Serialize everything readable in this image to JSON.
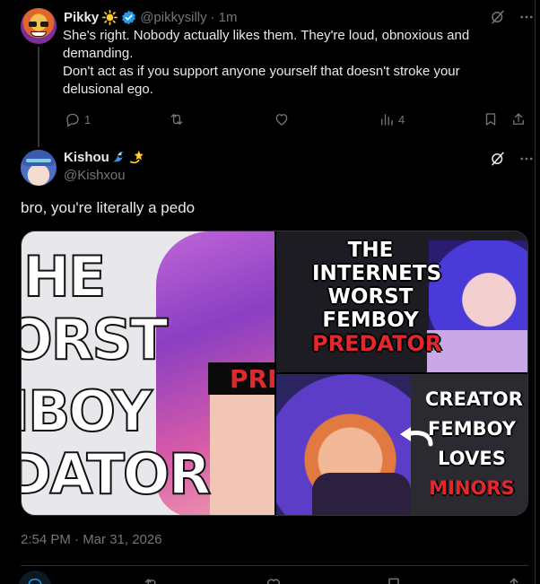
{
  "reply": {
    "author_name": "Pikky",
    "author_handle": "@pikkysilly",
    "separator": "·",
    "time": "1m",
    "text_lines": [
      "She's right. Nobody actually likes them. They're loud, obnoxious and demanding.",
      "Don't act as if you support anyone yourself that doesn't stroke your delusional ego."
    ],
    "stats": {
      "replies": "1",
      "retweets": "",
      "likes": "",
      "views": "4"
    }
  },
  "tweet": {
    "author_name": "Kishou",
    "author_handle": "@Kishxou",
    "text": "bro, you're literally a pedo",
    "timestamp": "2:54 PM · Mar 31, 2026",
    "media": {
      "image1_lines": [
        "HE",
        "ORST",
        "IBOY",
        "DATOR"
      ],
      "image1_overlay": "PRE",
      "image2_lines": [
        "THE",
        "INTERNETS",
        "WORST",
        "FEMBOY"
      ],
      "image2_highlight": "PREDATOR",
      "image3_lines": [
        "CREATOR",
        "FEMBOY",
        "LOVES"
      ],
      "image3_highlight": "MINORS"
    }
  },
  "colors": {
    "background": "#000000",
    "text_primary": "#e7e9ea",
    "text_secondary": "#71767b",
    "accent": "#1d9bf0",
    "divider": "#2f3336",
    "red_label": "#e0282e"
  },
  "icons": [
    "verified-badge-icon",
    "sun-emoji-icon",
    "wave-emoji-icon",
    "dizzy-emoji-icon",
    "grok-icon",
    "more-icon",
    "reply-icon",
    "retweet-icon",
    "like-icon",
    "views-icon",
    "bookmark-icon",
    "share-icon"
  ]
}
